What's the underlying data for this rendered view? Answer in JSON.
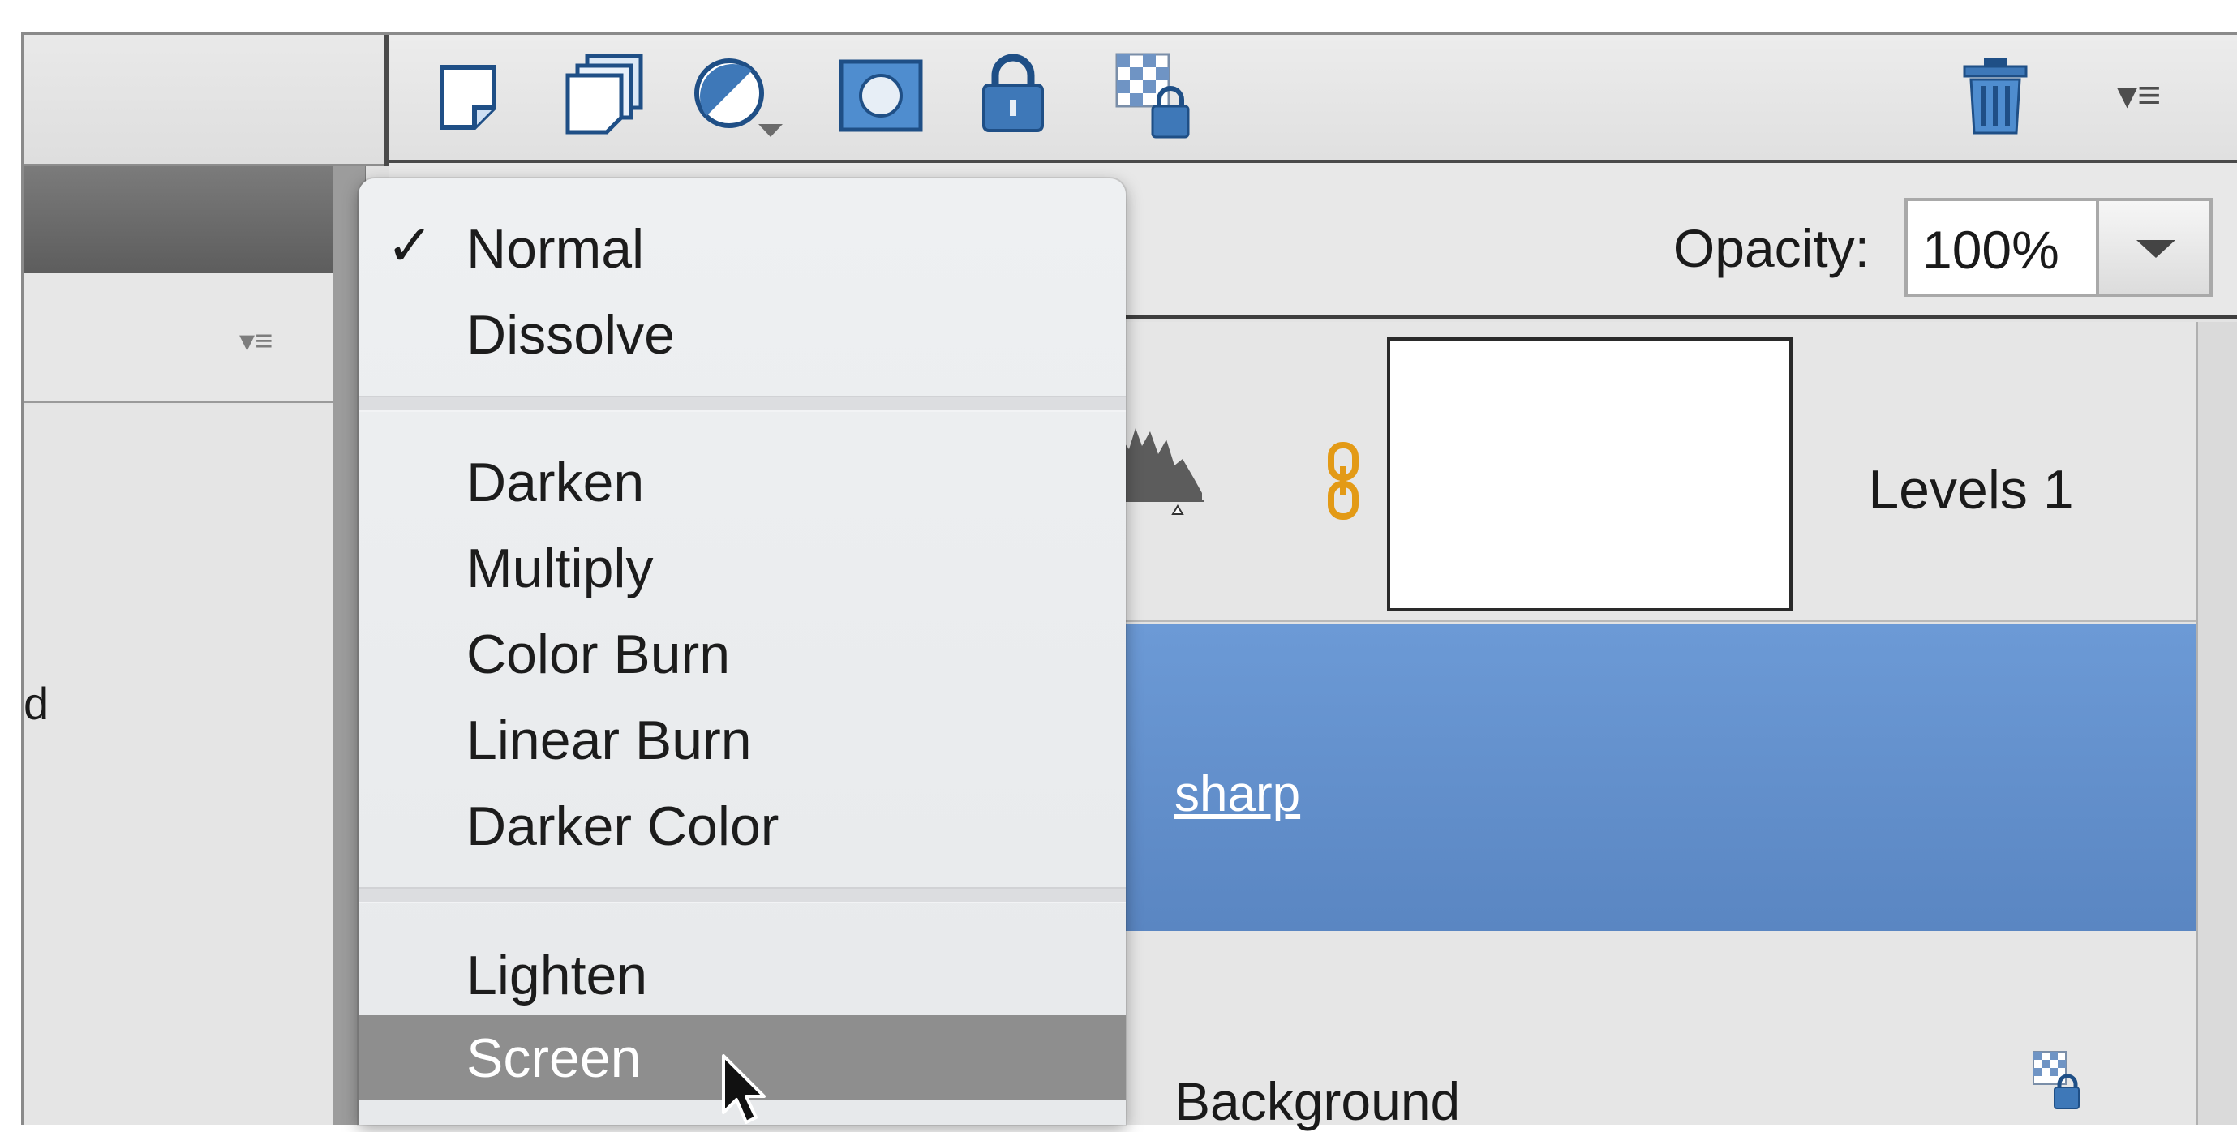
{
  "left_panel": {
    "menu_icon": "panel-menu-icon",
    "menu_glyph": "▾≡",
    "partial_text": "d"
  },
  "toolbar": {
    "icons": [
      "new-layer-icon",
      "new-group-icon",
      "adjustment-layer-icon",
      "layer-mask-icon",
      "lock-all-icon",
      "lock-transparency-icon",
      "trash-icon",
      "panel-menu-icon"
    ],
    "menu_glyph": "▾≡"
  },
  "blend": {
    "opacity_label": "Opacity:",
    "opacity_value": "100%"
  },
  "layers": [
    {
      "name": "Levels 1",
      "type": "adjustment",
      "selected": false
    },
    {
      "name": "sharp",
      "type": "pixel",
      "selected": true
    },
    {
      "name": "Background",
      "type": "background",
      "locked": true
    }
  ],
  "blend_menu": {
    "check_glyph": "✓",
    "groups": [
      [
        "Normal",
        "Dissolve"
      ],
      [
        "Darken",
        "Multiply",
        "Color Burn",
        "Linear Burn",
        "Darker Color"
      ],
      [
        "Lighten",
        "Screen"
      ]
    ],
    "selected": "Normal",
    "highlighted": "Screen"
  },
  "colors": {
    "selection_blue": "#6592cf",
    "menu_highlight": "#8e8e8e",
    "link_orange": "#e39a16",
    "icon_blue": "#3e78b8"
  }
}
